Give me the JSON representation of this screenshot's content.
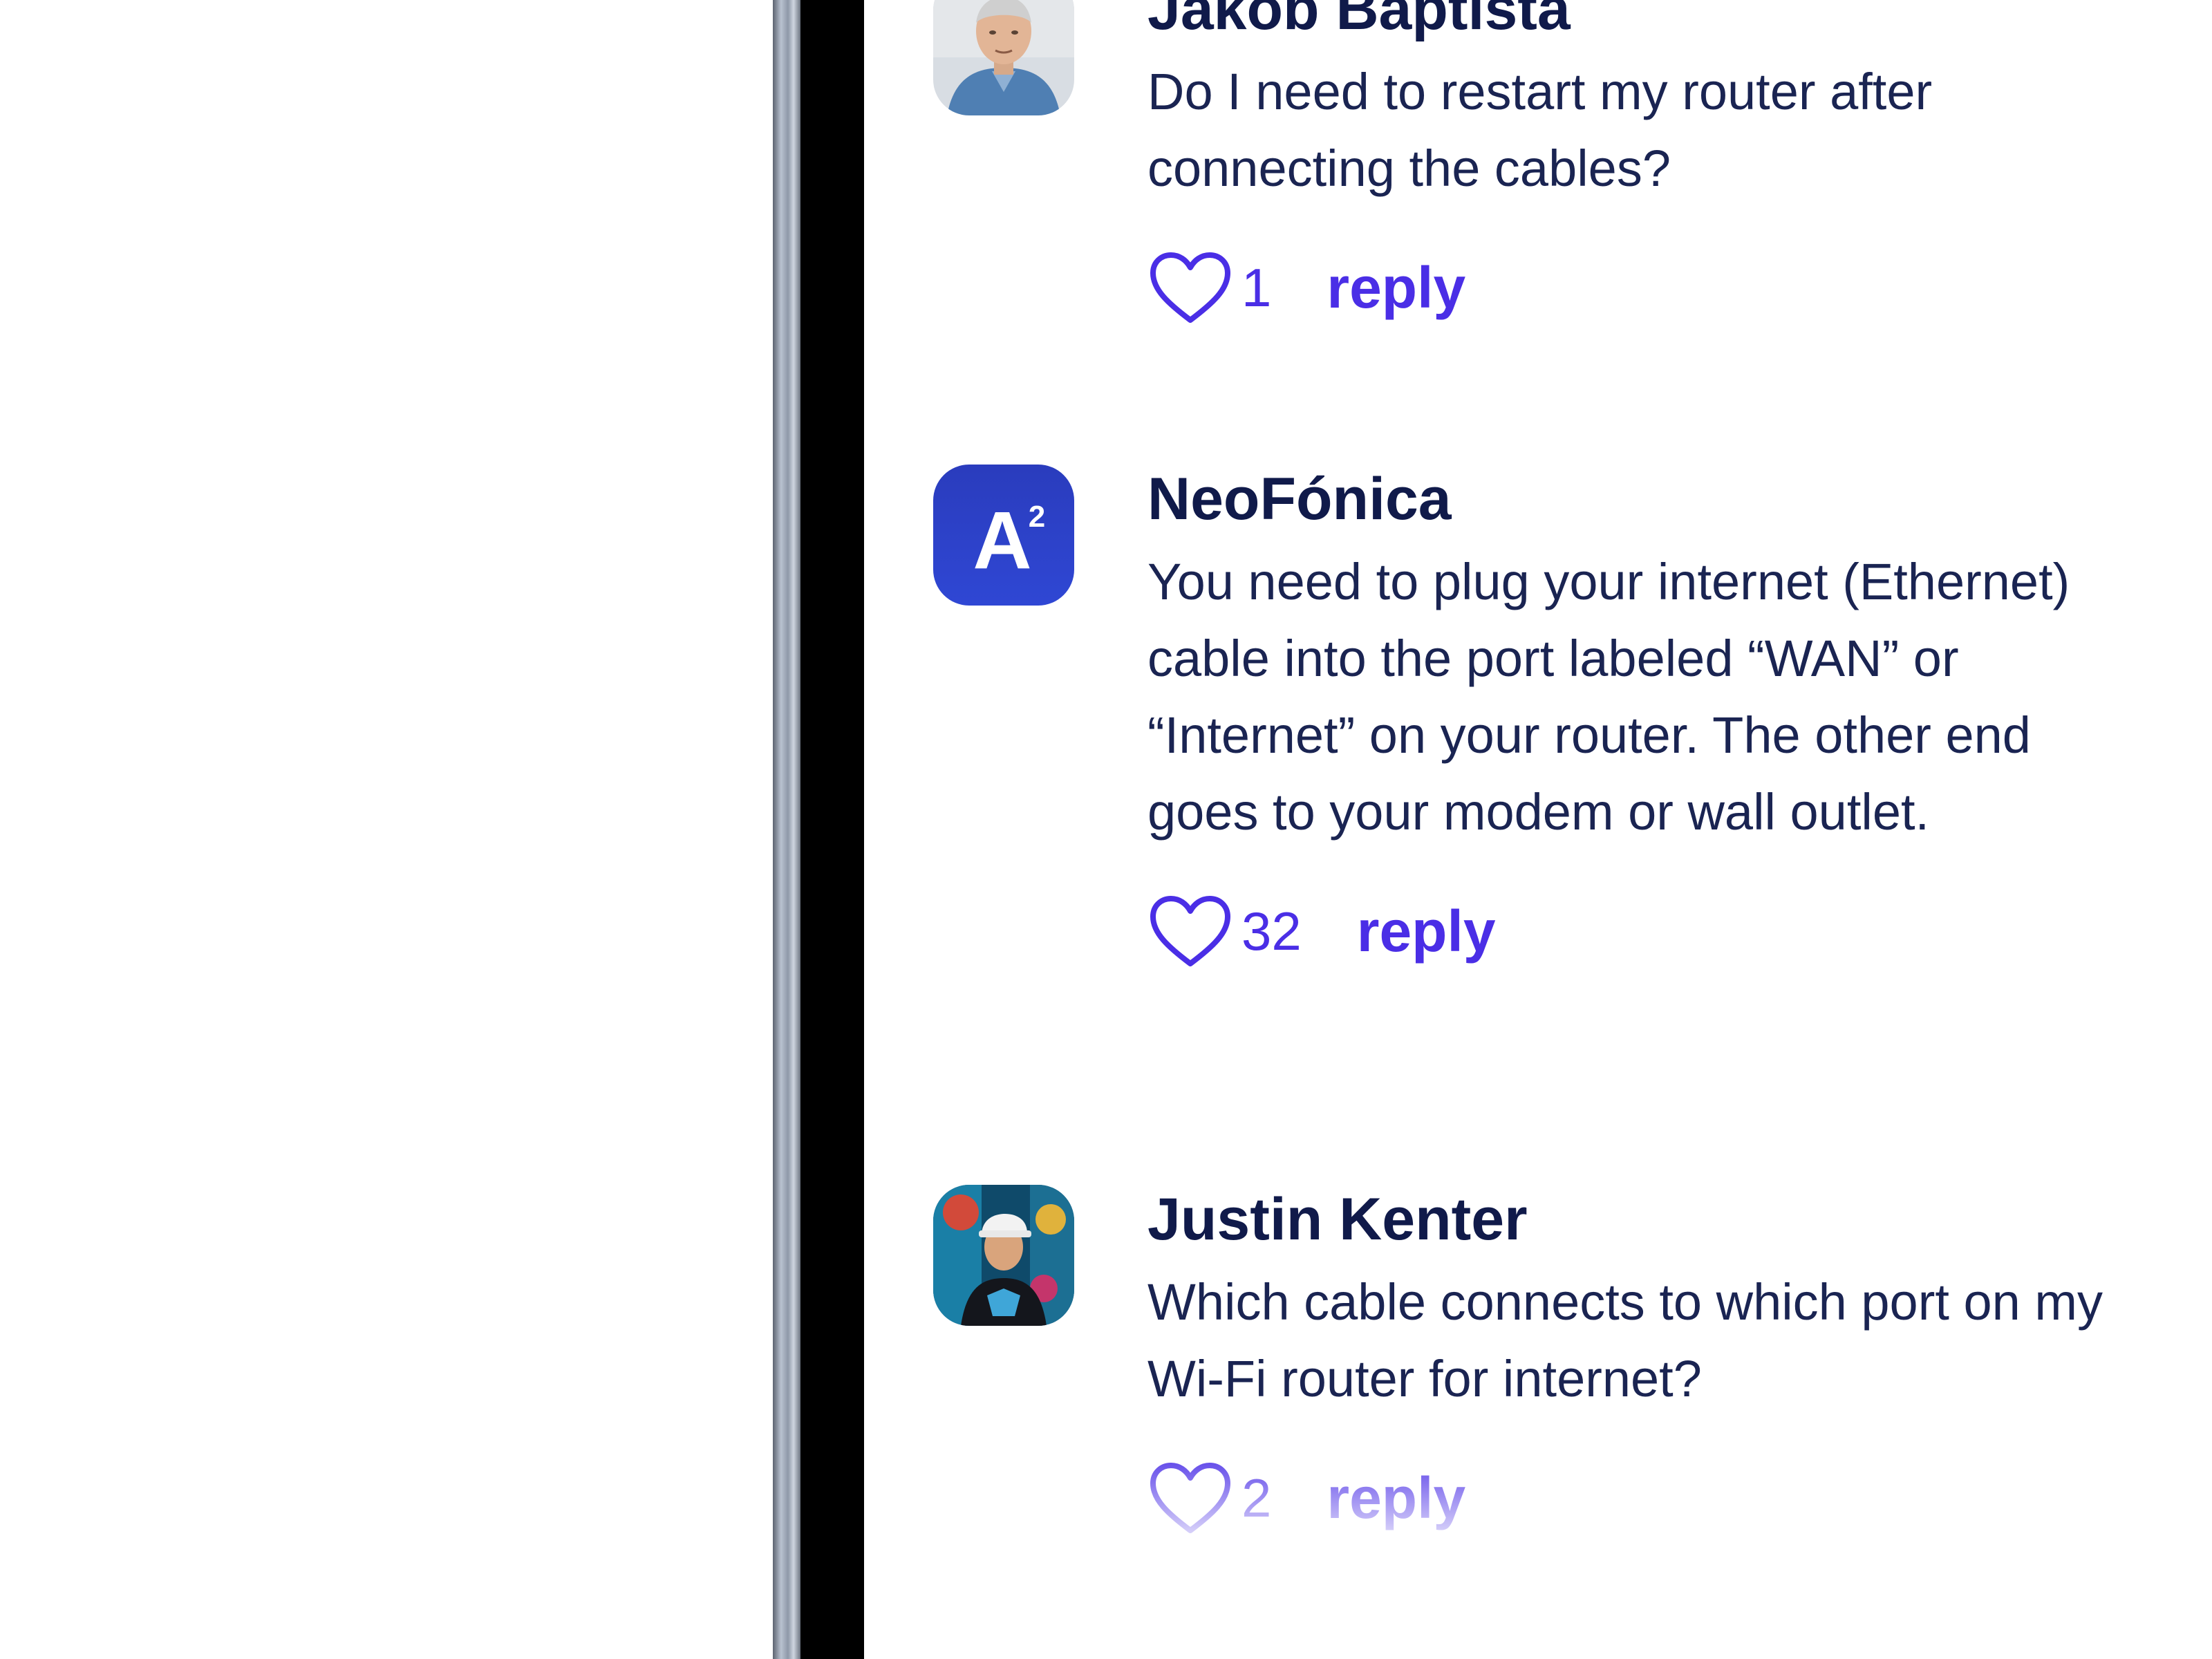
{
  "comments": [
    {
      "author": "Jakob Baptista",
      "text": "Do I need to restart my router after connecting the cables?",
      "likes": "1",
      "reply_label": "reply",
      "avatar_icon": "person-photo-avatar"
    },
    {
      "author": "NeoFónica",
      "text": "You need to plug your internet (Ethernet) cable into the port labeled “WAN” or “Internet” on your router. The other end goes to your modem or wall outlet.",
      "likes": "32",
      "reply_label": "reply",
      "avatar_icon": "brand-logo-avatar",
      "avatar_letter": "A",
      "avatar_sup": "2",
      "avatar_color": "#2b3fc4"
    },
    {
      "author": "Justin Kenter",
      "text": "Which cable connects to which port on my Wi-Fi router for internet?",
      "likes": "2",
      "reply_label": "reply",
      "avatar_icon": "person-photo-avatar"
    }
  ],
  "colors": {
    "accent": "#4a2ee6",
    "author_text": "#101a4a",
    "body_text": "#1a2452"
  }
}
